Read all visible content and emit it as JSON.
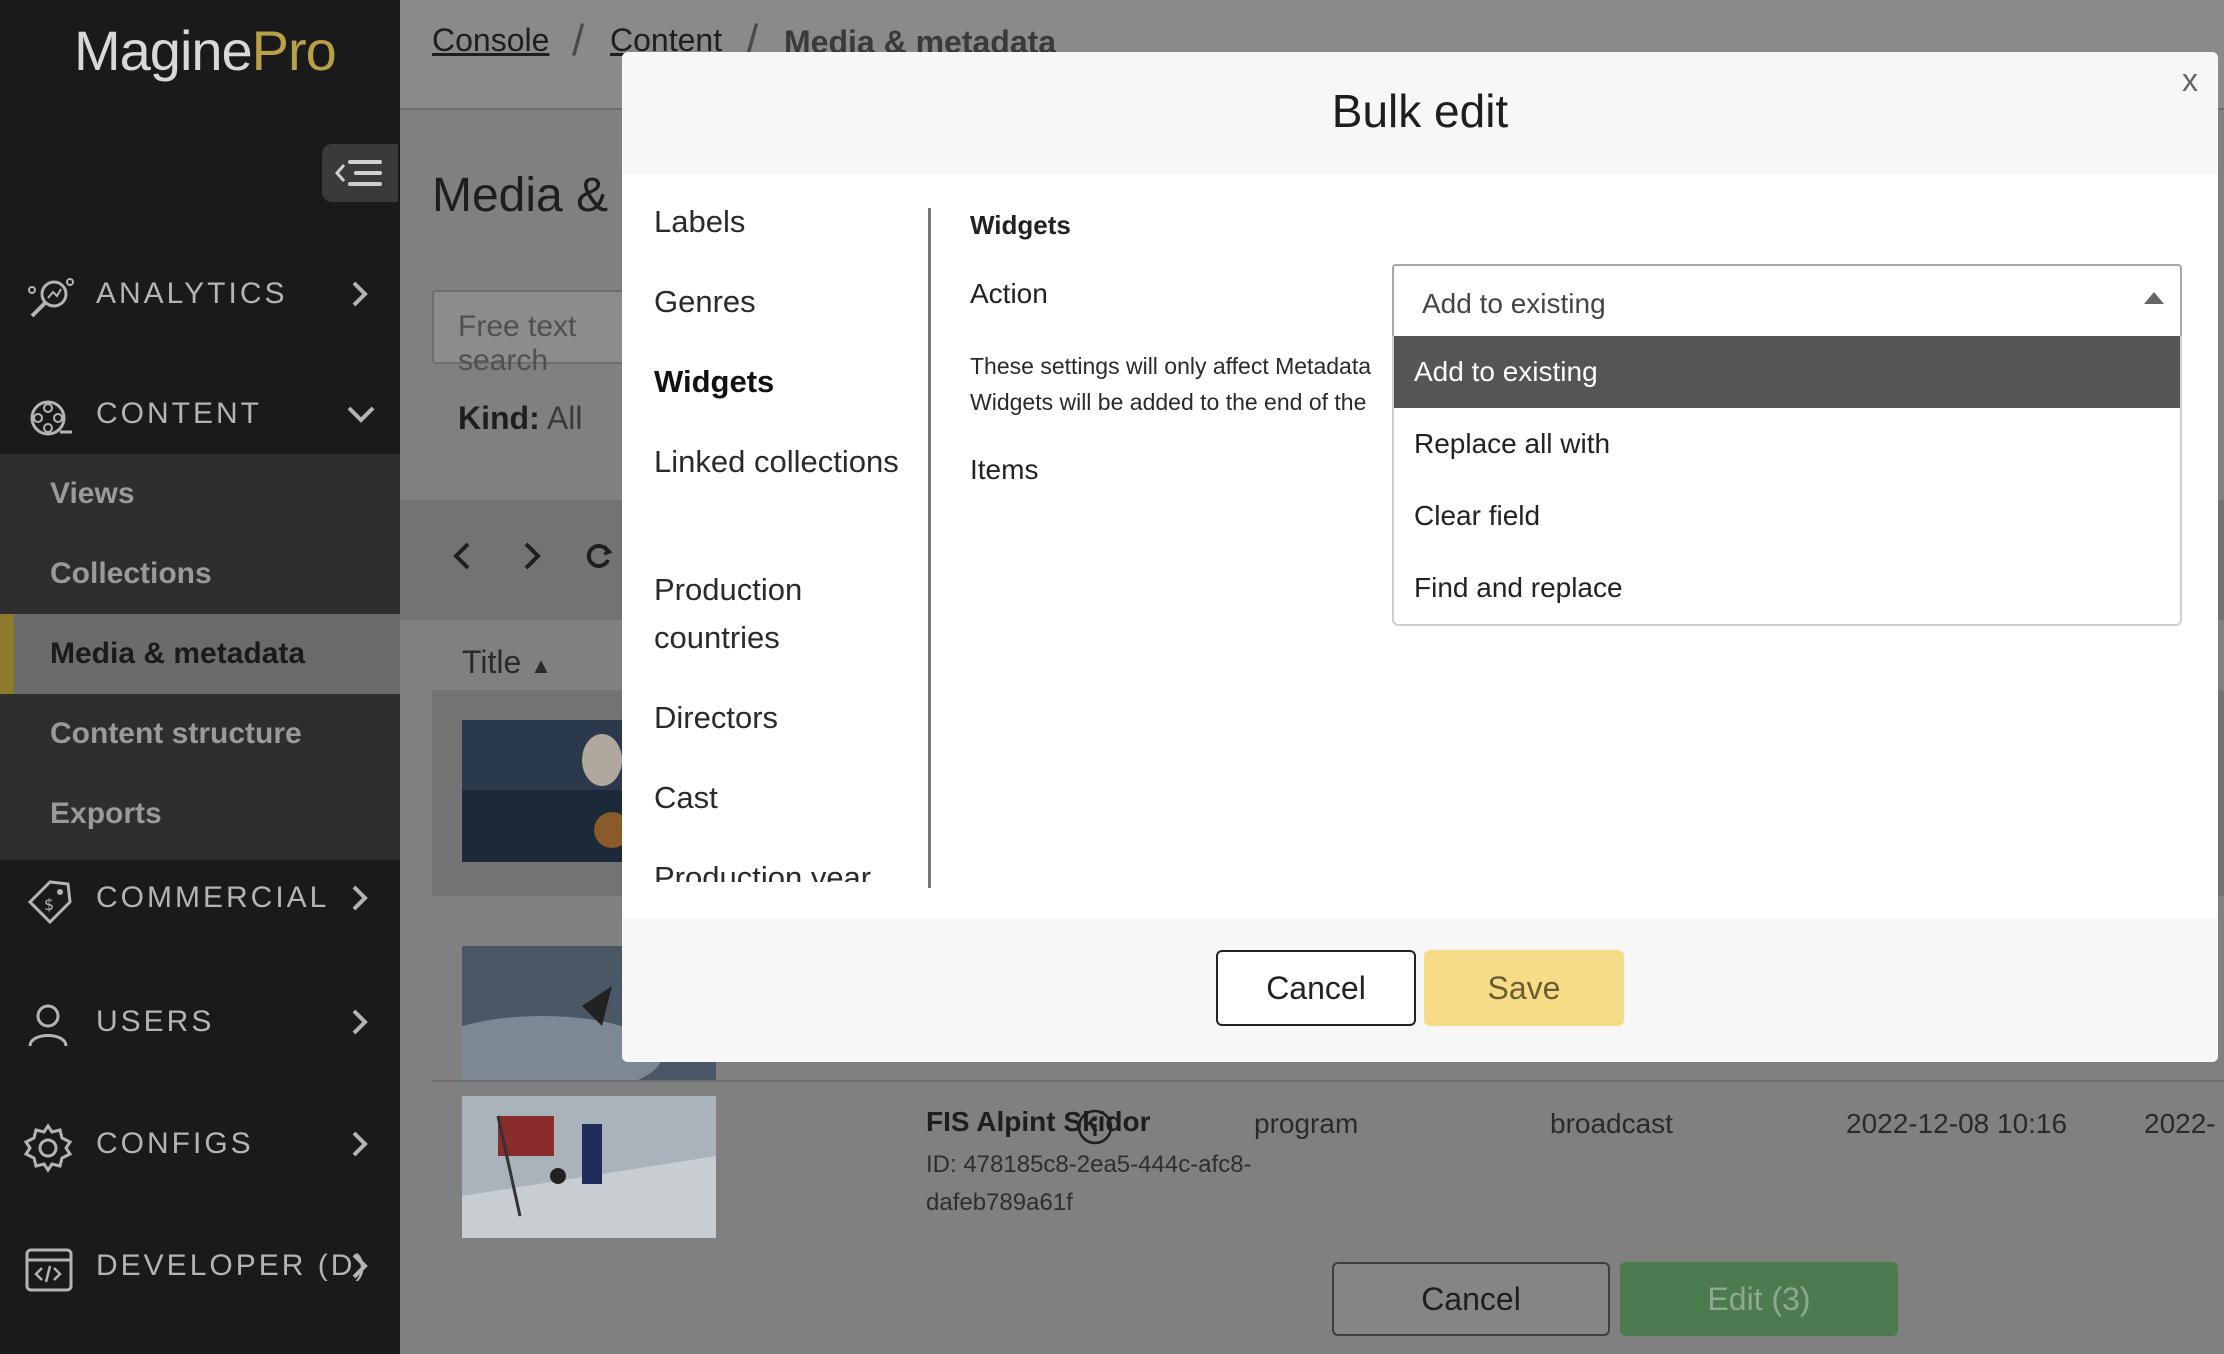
{
  "app": {
    "logo_main": "Magine",
    "logo_accent": "Pro"
  },
  "sidebar": {
    "sections": [
      {
        "label": "ANALYTICS",
        "icon": "analytics-icon"
      },
      {
        "label": "CONTENT",
        "icon": "film-reel-icon"
      },
      {
        "label": "COMMERCIAL",
        "icon": "price-tag-icon"
      },
      {
        "label": "USERS",
        "icon": "user-icon"
      },
      {
        "label": "CONFIGS",
        "icon": "gear-icon"
      },
      {
        "label": "DEVELOPER (D)",
        "icon": "code-window-icon"
      }
    ],
    "content_items": [
      "Views",
      "Collections",
      "Media & metadata",
      "Content structure",
      "Exports"
    ],
    "active_item": "Media & metadata",
    "accent_color": "#b8a047"
  },
  "breadcrumb": {
    "items": [
      "Console",
      "Content"
    ],
    "current": "Media & metadata"
  },
  "page": {
    "title": "Media & metadata",
    "search_placeholder": "Free text search",
    "kind_label": "Kind:",
    "kind_value": "All",
    "title_column": "Title"
  },
  "rows": [
    {
      "title": "",
      "id": "",
      "kind": "",
      "type": "",
      "created": "",
      "updated": ""
    },
    {
      "title": "",
      "id": "",
      "kind": "",
      "type": "",
      "created": "",
      "updated": ""
    },
    {
      "title": "FIS Alpint Skidor",
      "id": "ID: 478185c8-2ea5-444c-afc8-dafeb789a61f",
      "kind": "program",
      "type": "broadcast",
      "created": "2022-12-08 10:16",
      "updated": "2022-"
    }
  ],
  "footer": {
    "cancel": "Cancel",
    "edit": "Edit (3)"
  },
  "modal": {
    "title": "Bulk edit",
    "close": "x",
    "fields": [
      "Labels",
      "Genres",
      "Widgets",
      "Linked collections",
      "Production countries",
      "Directors",
      "Cast",
      "Production year"
    ],
    "active_field": "Widgets",
    "section_title": "Widgets",
    "action_label": "Action",
    "info_line1": "These settings will only affect Metadata",
    "info_line2": "Widgets will be added to the end of the",
    "items_label": "Items",
    "select_value": "Add to existing",
    "options": [
      "Add to existing",
      "Replace all with",
      "Clear field",
      "Find and replace"
    ],
    "selected_option": "Add to existing",
    "cancel": "Cancel",
    "save": "Save",
    "save_color": "#f6dc86"
  }
}
